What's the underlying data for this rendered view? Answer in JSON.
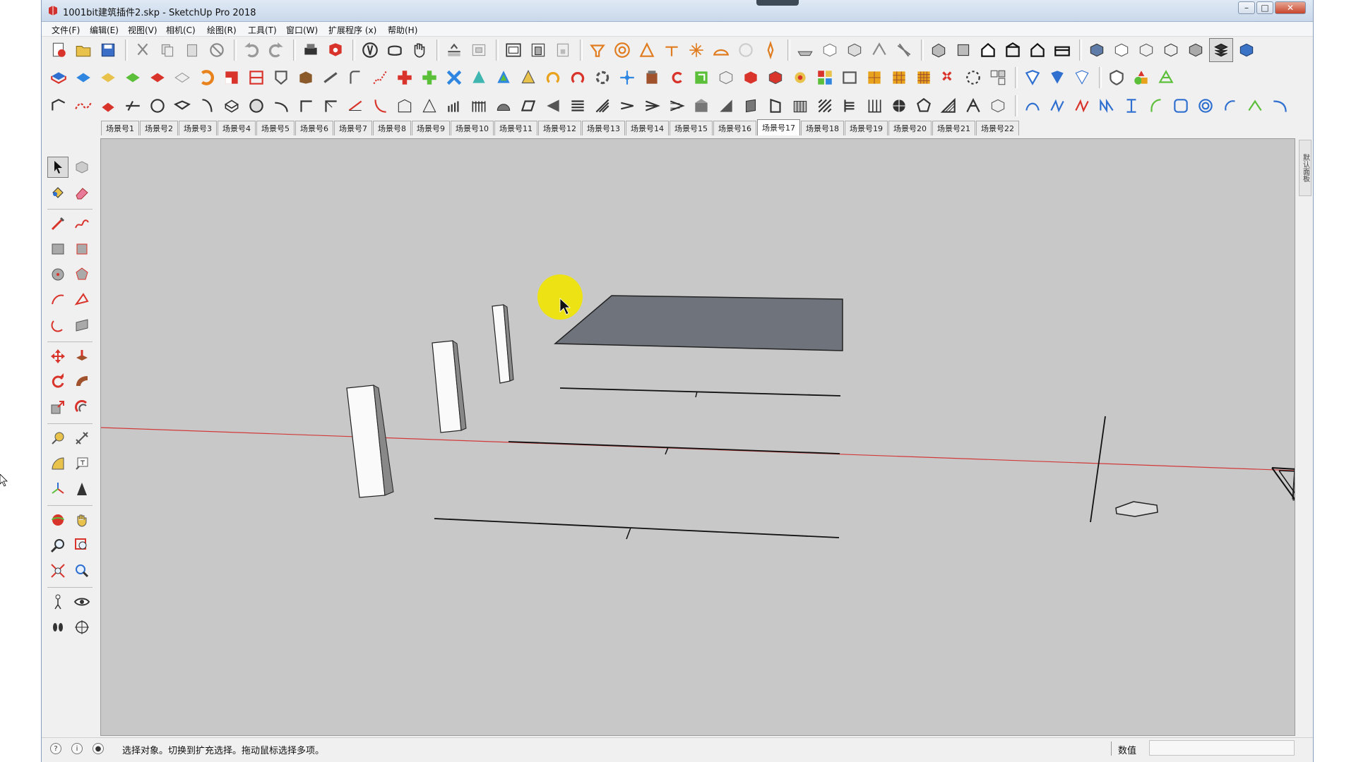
{
  "window": {
    "title": "1001bit建筑插件2.skp - SketchUp Pro 2018",
    "controls": {
      "minimize": "–",
      "maximize": "□",
      "close": "✕"
    }
  },
  "menu": [
    {
      "label": "文件(F)"
    },
    {
      "label": "编辑(E)"
    },
    {
      "label": "视图(V)"
    },
    {
      "label": "相机(C)"
    },
    {
      "label": "绘图(R)"
    },
    {
      "label": "工具(T)"
    },
    {
      "label": "窗口(W)"
    },
    {
      "label": "扩展程序 (x)"
    },
    {
      "label": "帮助(H)"
    }
  ],
  "scene_tabs": [
    "场景号1",
    "场景号2",
    "场景号3",
    "场景号4",
    "场景号5",
    "场景号6",
    "场景号7",
    "场景号8",
    "场景号9",
    "场景号10",
    "场景号11",
    "场景号12",
    "场景号13",
    "场景号14",
    "场景号15",
    "场景号16",
    "场景号17",
    "场景号18",
    "场景号19",
    "场景号20",
    "场景号21",
    "场景号22"
  ],
  "active_scene": "场景号17",
  "right_tray_label": "默认面板",
  "status": {
    "message": "选择对象。切换到扩充选择。拖动鼠标选择多项。",
    "vcb_label": "数值",
    "vcb_value": ""
  },
  "icons": {
    "toolbar_color_primary": "#d9342b",
    "toolbar_color_secondary": "#2f6fcf",
    "toolbar_color_accent": "#e8a21c"
  },
  "viewport": {
    "background": "#c8c8c8",
    "face_fill": "#6f747c",
    "red_axis": "#d23a3a",
    "highlight": "#f1e600"
  }
}
